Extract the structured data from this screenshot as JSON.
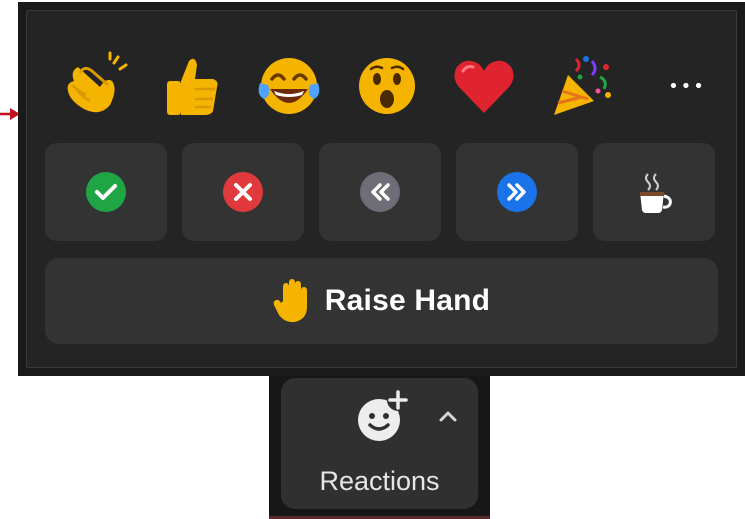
{
  "panel": {
    "emoji_reactions": [
      {
        "name": "clapping-hands",
        "glyph": "👏"
      },
      {
        "name": "thumbs-up",
        "glyph": "👍"
      },
      {
        "name": "tears-of-joy",
        "glyph": "😂"
      },
      {
        "name": "open-mouth",
        "glyph": "😮"
      },
      {
        "name": "red-heart",
        "glyph": "❤️"
      },
      {
        "name": "party-popper",
        "glyph": "🎉"
      }
    ],
    "more_label": "•••",
    "status_buttons": [
      {
        "name": "yes",
        "icon": "check-icon",
        "color": "#1fa544"
      },
      {
        "name": "no",
        "icon": "x-icon",
        "color": "#e0393e"
      },
      {
        "name": "slow-down",
        "icon": "rewind-icon",
        "color": "#6e6e78"
      },
      {
        "name": "speed-up",
        "icon": "fast-forward-icon",
        "color": "#1a73e8"
      },
      {
        "name": "coffee",
        "icon": "coffee-icon",
        "color": "#ffffff"
      }
    ],
    "raise_hand": {
      "emoji": "✋",
      "label": "Raise Hand"
    }
  },
  "toolbar": {
    "reactions_label": "Reactions"
  },
  "colors": {
    "panel_bg": "#242424",
    "button_bg": "#333333",
    "accent_arrow": "#c0121d"
  }
}
